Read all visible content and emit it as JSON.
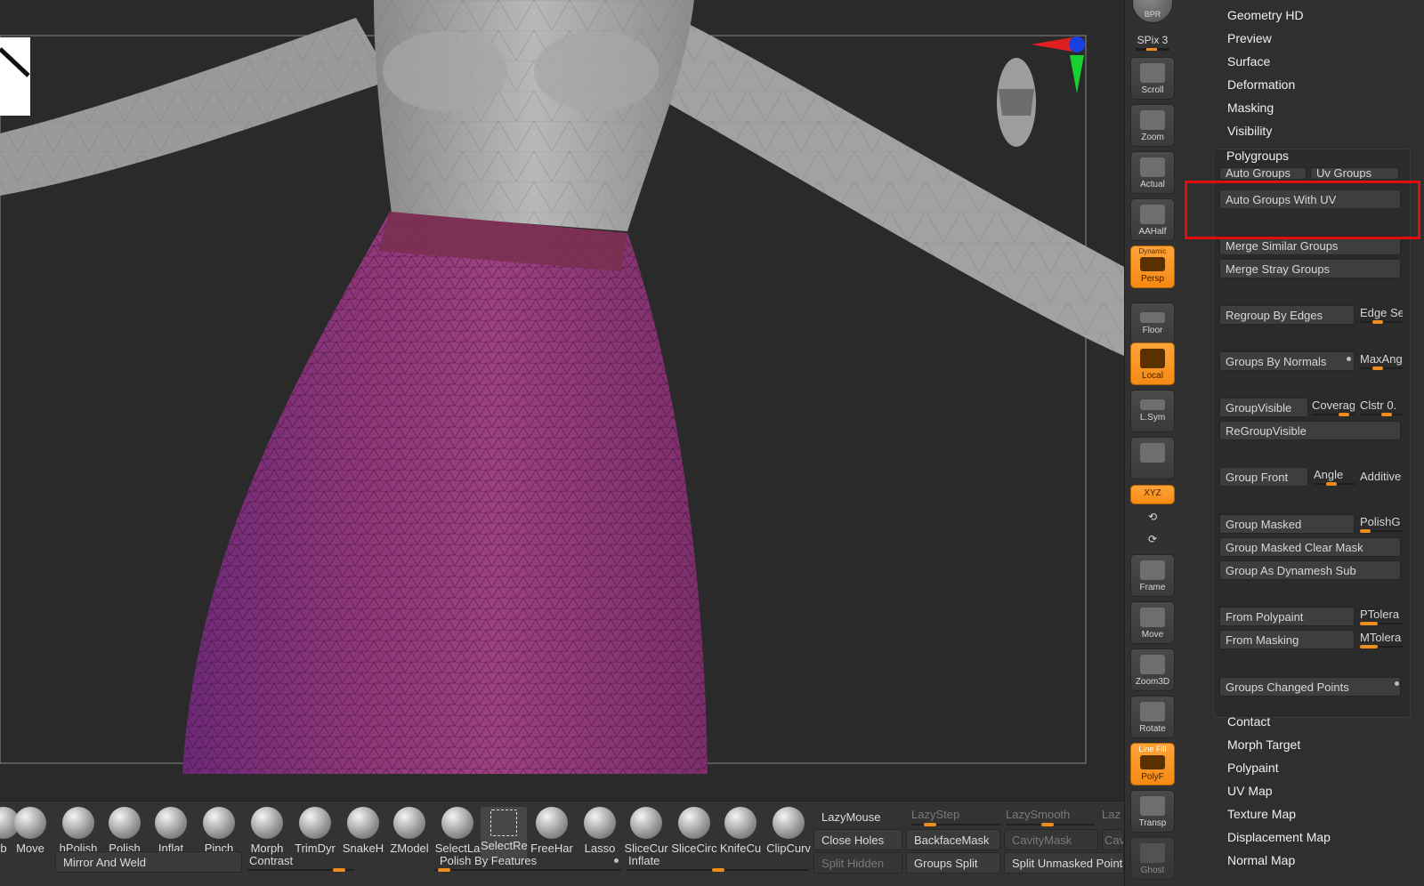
{
  "toolbar": {
    "bpr_label": "BPR",
    "spix_label": "SPix 3",
    "buttons": [
      {
        "label": "Scroll",
        "active": false
      },
      {
        "label": "Zoom",
        "active": false
      },
      {
        "label": "Actual",
        "active": false
      },
      {
        "label": "AAHalf",
        "active": false
      },
      {
        "label": "Persp",
        "active": true
      },
      {
        "label": "Floor",
        "active": false
      },
      {
        "label": "Local",
        "active": true
      },
      {
        "label": "L.Sym",
        "active": false
      },
      {
        "label": "",
        "active": false
      },
      {
        "label": "Frame",
        "active": false
      },
      {
        "label": "Move",
        "active": false
      },
      {
        "label": "Zoom3D",
        "active": false
      },
      {
        "label": "Rotate",
        "active": false
      },
      {
        "label": "PolyF",
        "active": true
      },
      {
        "label": "Transp",
        "active": false
      },
      {
        "label": "Ghost",
        "active": false
      }
    ],
    "dynamic_label": "Dynamic",
    "linefill_label": "Line Fill",
    "xyz_label": "XYZ"
  },
  "menu_top": [
    "Geometry HD",
    "Preview",
    "Surface",
    "Deformation",
    "Masking",
    "Visibility"
  ],
  "polygroups": {
    "title": "Polygroups",
    "auto_groups": "Auto Groups",
    "uv_groups": "Uv Groups",
    "auto_groups_with_uv": "Auto Groups With UV",
    "merge_similar": "Merge Similar Groups",
    "merge_stray": "Merge Stray Groups",
    "regroup_by_edges": "Regroup By Edges",
    "edge_se": "Edge Se",
    "groups_by_normals": "Groups By Normals",
    "maxang": "MaxAng",
    "group_visible": "GroupVisible",
    "coverage": "Coverag",
    "clstr": "Clstr 0.",
    "regroup_visible": "ReGroupVisible",
    "group_front": "Group Front",
    "angle": "Angle",
    "additive": "Additive",
    "group_masked": "Group Masked",
    "polish_g": "PolishG",
    "group_masked_clear": "Group Masked Clear Mask",
    "group_as_dynamesh": "Group As Dynamesh Sub",
    "from_polypaint": "From Polypaint",
    "ptolera": "PTolera",
    "from_masking": "From Masking",
    "mtolera": "MTolera",
    "groups_changed_points": "Groups Changed Points"
  },
  "menu_bottom": [
    "Contact",
    "Morph Target",
    "Polypaint",
    "UV Map",
    "Texture Map",
    "Displacement Map",
    "Normal Map"
  ],
  "shelf": {
    "brushes": [
      "b",
      "Move",
      "hPolish",
      "Polish",
      "Inflat",
      "Pinch",
      "Morph",
      "TrimDyr",
      "SnakeH",
      "ZModel",
      "SelectLa",
      "SelectRe",
      "FreeHar",
      "Lasso",
      "SliceCur",
      "SliceCirc",
      "KnifeCu",
      "ClipCurv"
    ],
    "mirror_and_weld": "Mirror And Weld",
    "contrast": "Contrast",
    "polish_by_features": "Polish By Features",
    "inflate": "Inflate",
    "lazymouse": "LazyMouse",
    "lazystep": "LazyStep",
    "lazysmooth": "LazySmooth",
    "laz": "Laz",
    "close_holes": "Close Holes",
    "backfacemask": "BackfaceMask",
    "cavitymask": "CavityMask",
    "cav": "Cav",
    "split_hidden": "Split Hidden",
    "groups_split": "Groups Split",
    "split_unmasked": "Split Unmasked Points"
  },
  "colors": {
    "accent": "#f08c1c",
    "highlight": "#e10d0d",
    "skirt": "#8a3472"
  }
}
